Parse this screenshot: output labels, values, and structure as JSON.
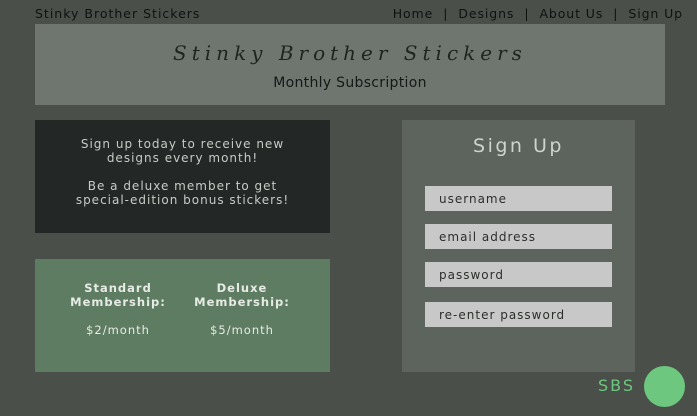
{
  "site": {
    "brand": "Stinky Brother Stickers"
  },
  "nav": {
    "items": [
      {
        "label": "Home"
      },
      {
        "label": "Designs"
      },
      {
        "label": "About Us"
      },
      {
        "label": "Sign Up"
      }
    ],
    "separator": "|"
  },
  "header": {
    "title": "Stinky Brother Stickers",
    "subtitle": "Monthly Subscription"
  },
  "info": {
    "paragraph1": "Sign up today to receive new designs every month!",
    "paragraph2": "Be a deluxe member to get special-edition bonus stickers!"
  },
  "plans": [
    {
      "name": "Standard Membership:",
      "price": "$2/month"
    },
    {
      "name": "Deluxe Membership:",
      "price": "$5/month"
    }
  ],
  "signup": {
    "heading": "Sign Up",
    "fields": [
      {
        "placeholder": "username"
      },
      {
        "placeholder": "email address"
      },
      {
        "placeholder": "password"
      },
      {
        "placeholder": "re-enter password"
      }
    ]
  },
  "logo": {
    "text": "SBS"
  },
  "colors": {
    "page_background": "#4a4f4a",
    "header_background": "#6e766f",
    "info_background": "#232826",
    "plans_background": "#5e7c62",
    "signup_background": "#5c645d",
    "input_background": "#c8c8c8",
    "accent_green": "#6dc77f"
  }
}
